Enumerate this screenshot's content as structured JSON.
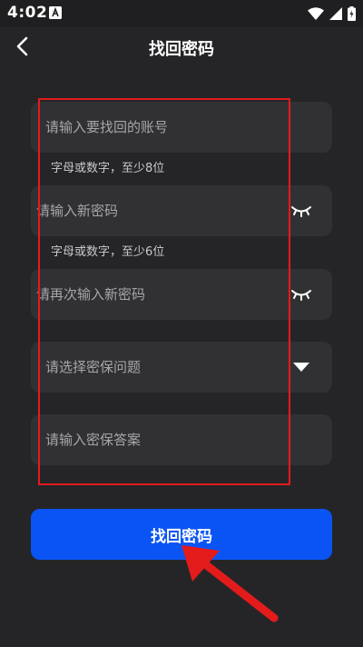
{
  "status_bar": {
    "time": "4:02",
    "notification_icon": "text-a-badge-icon",
    "icons": [
      "wifi-icon",
      "cellular-signal-icon",
      "battery-charging-icon"
    ]
  },
  "header": {
    "back_icon": "chevron-left-icon",
    "title": "找回密码"
  },
  "form": {
    "account": {
      "placeholder": "请输入要找回的账号",
      "value": "",
      "hint": "字母或数字，至少8位"
    },
    "new_password": {
      "placeholder": "请输入新密码",
      "value": "",
      "toggle_icon": "eye-closed-icon",
      "hint": "字母或数字，至少6位"
    },
    "confirm_password": {
      "placeholder": "请再次输入新密码",
      "value": "",
      "toggle_icon": "eye-closed-icon"
    },
    "security_question": {
      "placeholder": "请选择密保问题",
      "value": "",
      "dropdown_icon": "triangle-down-icon"
    },
    "security_answer": {
      "placeholder": "请输入密保答案",
      "value": ""
    }
  },
  "submit": {
    "label": "找回密码"
  },
  "colors": {
    "background": "#252528",
    "field_background": "#313133",
    "primary_button": "#0b54f4",
    "annotation_red": "#e31b1b",
    "placeholder_text": "#a6a6ab"
  }
}
